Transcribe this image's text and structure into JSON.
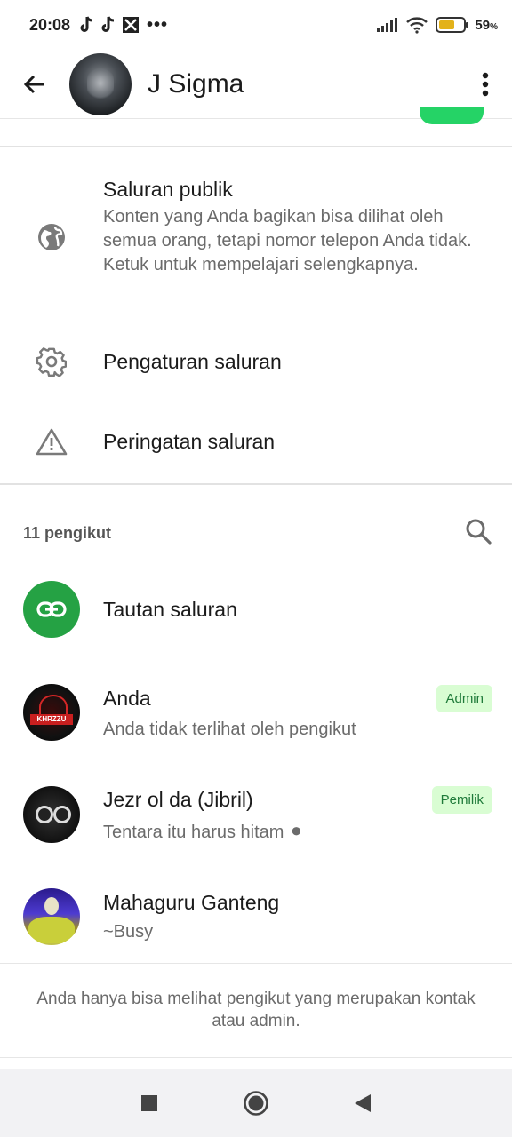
{
  "status_bar": {
    "time": "20:08",
    "dots": "•••",
    "battery_percent": "59",
    "battery_percent_sign": "%"
  },
  "header": {
    "title": "J Sigma"
  },
  "settings": {
    "public": {
      "title": "Saluran publik",
      "description": "Konten yang Anda bagikan bisa dilihat oleh semua orang, tetapi nomor telepon Anda tidak. Ketuk untuk mempelajari selengkapnya."
    },
    "channel_settings": {
      "title": "Pengaturan saluran"
    },
    "channel_warning": {
      "title": "Peringatan saluran"
    }
  },
  "followers": {
    "count_label": "11 pengikut"
  },
  "list": {
    "link": {
      "title": "Tautan saluran"
    },
    "members": [
      {
        "name": "Anda",
        "status": "Anda tidak terlihat oleh pengikut",
        "badge": "Admin"
      },
      {
        "name": "Jezr ol da (Jibril)",
        "status": "Tentara itu harus hitam ⚫",
        "badge": "Pemilik"
      },
      {
        "name": "Mahaguru Ganteng",
        "status": "~Busy",
        "badge": ""
      }
    ]
  },
  "footnote": "Anda hanya bisa melihat pengikut yang merupakan kontak atau admin.",
  "colors": {
    "accent_green": "#25d366",
    "badge_bg": "#d9fdd3",
    "badge_text": "#1f7a3a"
  },
  "icons": {
    "back": "arrow-left-icon",
    "more": "more-vertical-icon",
    "public": "globe-icon",
    "settings": "gear-icon",
    "warning": "warning-triangle-icon",
    "search": "search-icon",
    "link": "link-icon"
  }
}
